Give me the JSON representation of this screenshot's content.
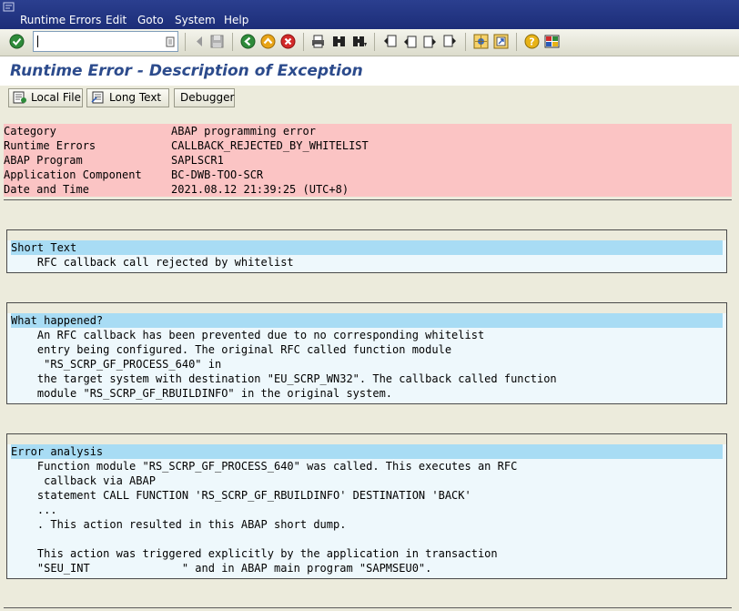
{
  "menu": {
    "items": [
      "Runtime Errors",
      "Edit",
      "Goto",
      "System",
      "Help"
    ]
  },
  "toolbar": {
    "command_field_value": ""
  },
  "page": {
    "title": "Runtime Error - Description of Exception"
  },
  "app_buttons": {
    "local_file": "Local File",
    "long_text": "Long Text",
    "debugger": "Debugger"
  },
  "header": {
    "rows": [
      {
        "label": "Category",
        "value": "ABAP programming error"
      },
      {
        "label": "Runtime Errors",
        "value": "CALLBACK_REJECTED_BY_WHITELIST"
      },
      {
        "label": "ABAP Program",
        "value": "SAPLSCR1"
      },
      {
        "label": "Application Component",
        "value": "BC-DWB-TOO-SCR"
      },
      {
        "label": "Date and Time",
        "value": "2021.08.12 21:39:25 (UTC+8)"
      }
    ]
  },
  "sections": {
    "short_text": {
      "heading": "Short Text",
      "lines": [
        "    RFC callback call rejected by whitelist"
      ]
    },
    "what_happened": {
      "heading": "What happened?",
      "lines": [
        "    An RFC callback has been prevented due to no corresponding whitelist",
        "    entry being configured. The original RFC called function module",
        "     \"RS_SCRP_GF_PROCESS_640\" in",
        "    the target system with destination \"EU_SCRP_WN32\". The callback called function",
        "    module \"RS_SCRP_GF_RBUILDINFO\" in the original system."
      ]
    },
    "error_analysis": {
      "heading": "Error analysis",
      "lines": [
        "    Function module \"RS_SCRP_GF_PROCESS_640\" was called. This executes an RFC",
        "     callback via ABAP",
        "    statement CALL FUNCTION 'RS_SCRP_GF_RBUILDINFO' DESTINATION 'BACK'",
        "    ...",
        "    . This action resulted in this ABAP short dump.",
        "",
        "    This action was triggered explicitly by the application in transaction",
        "    \"SEU_INT              \" and in ABAP main program \"SAPMSEU0\"."
      ]
    }
  },
  "icons": {
    "toolbar": [
      "enter-icon",
      "back-arrow-icon",
      "save-icon",
      "back-icon",
      "exit-icon",
      "cancel-icon",
      "print-icon",
      "find-icon",
      "find-next-icon",
      "first-page-icon",
      "previous-page-icon",
      "next-page-icon",
      "last-page-icon",
      "create-session-icon",
      "shortcut-icon",
      "help-icon",
      "layout-menu-icon"
    ],
    "app": [
      "local-file-icon",
      "long-text-icon"
    ]
  },
  "colors": {
    "menubar": "#1c2d78",
    "title": "#2c4b8c",
    "header_row_bg": "#fbc4c4",
    "section_heading_bg": "#a8dcf4",
    "section_body_bg": "#eef8fc"
  }
}
